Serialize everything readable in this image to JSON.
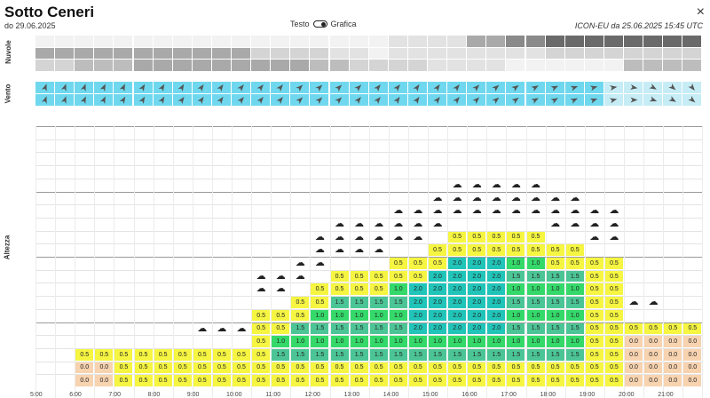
{
  "title": "Sotto Ceneri",
  "subtitle": "do 29.06.2025",
  "toggle": {
    "left_label": "Testo",
    "right_label": "Grafica"
  },
  "model_info": "ICON-EU da 25.06.2025 15:45 UTC",
  "close_label": "×",
  "sections": {
    "clouds": "Nuvole",
    "wind": "Vento",
    "altitude": "Altezza"
  },
  "cloud_rows": [
    {
      "label": "H",
      "values": [
        "",
        "",
        "",
        "",
        "",
        "",
        "",
        "",
        "",
        "",
        "",
        "",
        "",
        "",
        "",
        "",
        "",
        "",
        "1",
        "1",
        "1",
        "1",
        "4",
        "4",
        "6",
        "6",
        "8",
        "8",
        "8",
        "8",
        "8",
        "8",
        "8",
        "8"
      ]
    },
    {
      "label": "M",
      "values": [
        "4",
        "4",
        "4",
        "4",
        "4",
        "4",
        "4",
        "4",
        "4",
        "4",
        "4",
        "2",
        "2",
        "2",
        "2",
        "1",
        "1",
        "",
        "1",
        "1",
        "1",
        "1",
        "1",
        "1",
        "1",
        "1",
        "2",
        "2",
        "2",
        "2",
        "2",
        "2",
        "2",
        "2"
      ]
    },
    {
      "label": "T",
      "values": [
        "2",
        "2",
        "3",
        "3",
        "3",
        "4",
        "4",
        "4",
        "4",
        "4",
        "4",
        "4",
        "4",
        "4",
        "3",
        "3",
        "2",
        "2",
        "2",
        "2",
        "1",
        "1",
        "1",
        "1",
        "",
        "",
        "",
        "",
        "",
        "",
        "3",
        "3",
        "3",
        "3"
      ]
    }
  ],
  "wind_rows": [
    {
      "label": "F",
      "rotations": [
        20,
        20,
        20,
        25,
        25,
        30,
        30,
        30,
        35,
        35,
        40,
        40,
        40,
        45,
        45,
        45,
        45,
        40,
        40,
        35,
        35,
        40,
        45,
        50,
        55,
        60,
        65,
        70,
        75,
        80,
        100,
        120,
        130,
        140
      ]
    },
    {
      "label": "H",
      "rotations": [
        20,
        20,
        25,
        25,
        30,
        30,
        30,
        35,
        35,
        35,
        40,
        40,
        40,
        45,
        45,
        45,
        40,
        40,
        35,
        35,
        40,
        40,
        45,
        50,
        55,
        60,
        60,
        65,
        70,
        75,
        90,
        110,
        120,
        130
      ]
    }
  ],
  "y_axis": {
    "ticks": [
      "4000",
      "3800",
      "3600",
      "3400",
      "3200",
      "3000",
      "2800",
      "2600",
      "2400",
      "2200",
      "2000",
      "1800",
      "1600",
      "1400",
      "1200",
      "1000",
      "800",
      "600",
      "400",
      "200"
    ]
  },
  "x_axis": {
    "labels": [
      "5:00",
      "6:00",
      "7:00",
      "8:00",
      "9:00",
      "10:00",
      "11:00",
      "12:00",
      "13:00",
      "14:00",
      "15:00",
      "16:00",
      "17:00",
      "18:00",
      "19:00",
      "20:00",
      "21:00"
    ]
  },
  "colors": {
    "panel_bg": "#f2f2f2",
    "wind_bg": "#6fd8ee",
    "level_0": "#f7d3b0",
    "level_05": "#f5f542",
    "level_1": "#34d96a",
    "level_15": "#4cc596",
    "level_2": "#21c4b8"
  },
  "thermals": [
    [
      "",
      "",
      "",
      "",
      "",
      "",
      "",
      "",
      "",
      "",
      "",
      "",
      "0.0",
      "0.0",
      "0.0",
      "",
      "",
      "",
      "",
      "",
      "",
      "",
      "",
      "",
      "",
      "",
      "",
      "",
      "",
      "",
      "",
      "",
      "",
      ""
    ],
    [
      "",
      "",
      "",
      "",
      "",
      "",
      "",
      "",
      "",
      "",
      "",
      "",
      "0.0",
      "0.0",
      "0.0",
      "0.0",
      "0.0",
      "0.0",
      "0.0",
      "",
      "",
      "",
      "",
      "",
      "",
      "",
      "",
      "",
      "",
      "",
      "",
      "",
      "",
      ""
    ],
    [
      "",
      "",
      "",
      "",
      "",
      "",
      "",
      "",
      "0.0",
      "0.0",
      "0.0",
      "0.5",
      "0.5",
      "0.5",
      "0.5",
      "0.5",
      "0.5",
      "0.5",
      "1.0",
      "1.0",
      "1.0",
      "1.0",
      "0.5",
      "0.5",
      "0.5",
      "0.5",
      "0.5",
      "0.5",
      "",
      "",
      "",
      "",
      "",
      ""
    ]
  ]
}
